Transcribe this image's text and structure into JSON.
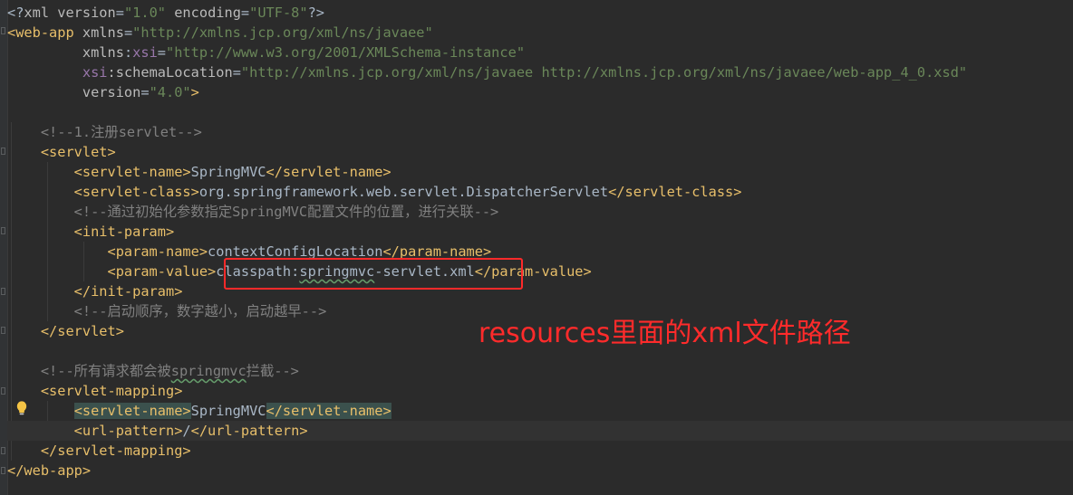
{
  "colors": {
    "background": "#2b2b2b",
    "tag": "#e8bf6a",
    "attribute": "#bababa",
    "namespace": "#9876aa",
    "string": "#6a8759",
    "comment": "#808080",
    "text": "#a9b7c6",
    "annotation": "#ff2b2b",
    "highlight_box": "#ff2a2a"
  },
  "editor": {
    "language": "xml",
    "lines": [
      [
        {
          "t": "<?",
          "c": "txt"
        },
        {
          "t": "xml version",
          "c": "attr"
        },
        {
          "t": "=",
          "c": "txt"
        },
        {
          "t": "\"1.0\"",
          "c": "str"
        },
        {
          "t": " encoding",
          "c": "attr"
        },
        {
          "t": "=",
          "c": "txt"
        },
        {
          "t": "\"UTF-8\"",
          "c": "str"
        },
        {
          "t": "?>",
          "c": "txt"
        }
      ],
      [
        {
          "t": "<web-app ",
          "c": "tag"
        },
        {
          "t": "xmlns",
          "c": "attr"
        },
        {
          "t": "=",
          "c": "txt"
        },
        {
          "t": "\"http://xmlns.jcp.org/xml/ns/javaee\"",
          "c": "str"
        }
      ],
      [
        {
          "t": "         xmlns",
          "c": "attr"
        },
        {
          "t": ":",
          "c": "txt"
        },
        {
          "t": "xsi",
          "c": "ns"
        },
        {
          "t": "=",
          "c": "txt"
        },
        {
          "t": "\"http://www.w3.org/2001/XMLSchema-instance\"",
          "c": "str"
        }
      ],
      [
        {
          "t": "         ",
          "c": "txt"
        },
        {
          "t": "xsi",
          "c": "ns"
        },
        {
          "t": ":schemaLocation",
          "c": "attr"
        },
        {
          "t": "=",
          "c": "txt"
        },
        {
          "t": "\"http://xmlns.jcp.org/xml/ns/javaee http://xmlns.jcp.org/xml/ns/javaee/web-app_4_0.xsd\"",
          "c": "str"
        }
      ],
      [
        {
          "t": "         version",
          "c": "attr"
        },
        {
          "t": "=",
          "c": "txt"
        },
        {
          "t": "\"4.0\"",
          "c": "str"
        },
        {
          "t": ">",
          "c": "tag"
        }
      ],
      [],
      [
        {
          "t": "    <!--1.注册servlet-->",
          "c": "cmt"
        }
      ],
      [
        {
          "t": "    <servlet>",
          "c": "tag"
        }
      ],
      [
        {
          "t": "        <servlet-name>",
          "c": "tag"
        },
        {
          "t": "SpringMVC",
          "c": "txt"
        },
        {
          "t": "</servlet-name>",
          "c": "tag"
        }
      ],
      [
        {
          "t": "        <servlet-class>",
          "c": "tag"
        },
        {
          "t": "org.springframework.web.servlet.DispatcherServlet",
          "c": "txt"
        },
        {
          "t": "</servlet-class>",
          "c": "tag"
        }
      ],
      [
        {
          "t": "        <!--通过初始化参数指定SpringMVC配置文件的位置，进行关联-->",
          "c": "cmt"
        }
      ],
      [
        {
          "t": "        <init-param>",
          "c": "tag"
        }
      ],
      [
        {
          "t": "            <param-name>",
          "c": "tag"
        },
        {
          "t": "contextConfigLocation",
          "c": "txt"
        },
        {
          "t": "</param-name>",
          "c": "tag"
        }
      ],
      [
        {
          "t": "            <param-value>",
          "c": "tag"
        },
        {
          "t": "classpath:",
          "c": "txt"
        },
        {
          "t": "springmvc",
          "c": "txt",
          "u": true
        },
        {
          "t": "-servlet.xml",
          "c": "txt"
        },
        {
          "t": "</param-value>",
          "c": "tag"
        }
      ],
      [
        {
          "t": "        </init-param>",
          "c": "tag"
        }
      ],
      [
        {
          "t": "        <!--启动顺序，数字越小，启动越早-->",
          "c": "cmt"
        }
      ],
      [
        {
          "t": "    </servlet>",
          "c": "tag"
        }
      ],
      [],
      [
        {
          "t": "    <!--所有请求都会被",
          "c": "cmt"
        },
        {
          "t": "springmvc",
          "c": "cmt",
          "u": true
        },
        {
          "t": "拦截-->",
          "c": "cmt"
        }
      ],
      [
        {
          "t": "    <servlet-mapping>",
          "c": "tag"
        }
      ],
      [
        {
          "t": "        ",
          "c": "txt"
        },
        {
          "t": "<servlet-name>",
          "c": "tag",
          "m": true
        },
        {
          "t": "SpringMVC",
          "c": "txt"
        },
        {
          "t": "</servlet-name>",
          "c": "tag",
          "m": true
        }
      ],
      [
        {
          "t": "        <url-pattern>",
          "c": "tag"
        },
        {
          "t": "/",
          "c": "txt"
        },
        {
          "t": "</url-pattern>",
          "c": "tag"
        }
      ],
      [
        {
          "t": "    </servlet-mapping>",
          "c": "tag"
        }
      ],
      [
        {
          "t": "</web-app>",
          "c": "tag"
        }
      ]
    ],
    "current_line": 21,
    "intention_bulb_icon": "lightbulb-icon"
  },
  "annotation": {
    "text": "resources里面的xml文件路径"
  }
}
